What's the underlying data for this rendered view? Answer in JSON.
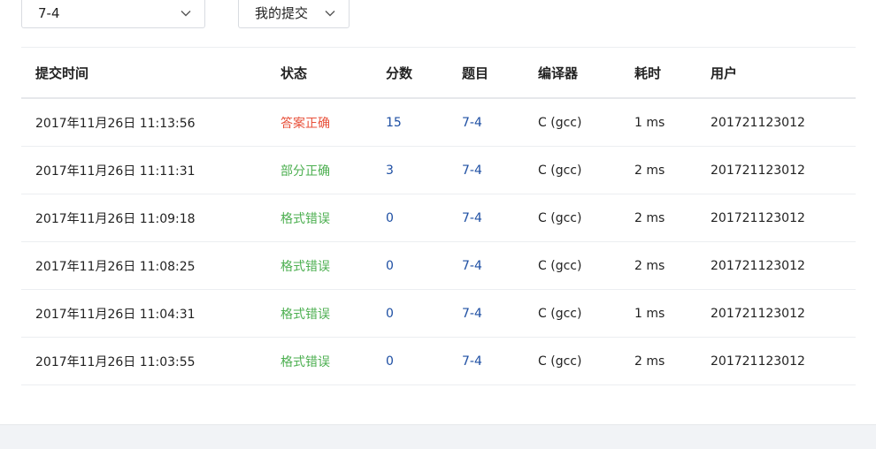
{
  "filters": {
    "problem_value": "7-4",
    "scope_value": "我的提交"
  },
  "table": {
    "headers": {
      "time": "提交时间",
      "status": "状态",
      "score": "分数",
      "problem": "题目",
      "compiler": "编译器",
      "duration": "耗时",
      "user": "用户"
    },
    "rows": [
      {
        "time": "2017年11月26日 11:13:56",
        "status": "答案正确",
        "status_type": "correct",
        "score": "15",
        "problem": "7-4",
        "compiler": "C (gcc)",
        "duration": "1 ms",
        "user": "201721123012"
      },
      {
        "time": "2017年11月26日 11:11:31",
        "status": "部分正确",
        "status_type": "partial",
        "score": "3",
        "problem": "7-4",
        "compiler": "C (gcc)",
        "duration": "2 ms",
        "user": "201721123012"
      },
      {
        "time": "2017年11月26日 11:09:18",
        "status": "格式错误",
        "status_type": "format",
        "score": "0",
        "problem": "7-4",
        "compiler": "C (gcc)",
        "duration": "2 ms",
        "user": "201721123012"
      },
      {
        "time": "2017年11月26日 11:08:25",
        "status": "格式错误",
        "status_type": "format",
        "score": "0",
        "problem": "7-4",
        "compiler": "C (gcc)",
        "duration": "2 ms",
        "user": "201721123012"
      },
      {
        "time": "2017年11月26日 11:04:31",
        "status": "格式错误",
        "status_type": "format",
        "score": "0",
        "problem": "7-4",
        "compiler": "C (gcc)",
        "duration": "1 ms",
        "user": "201721123012"
      },
      {
        "time": "2017年11月26日 11:03:55",
        "status": "格式错误",
        "status_type": "format",
        "score": "0",
        "problem": "7-4",
        "compiler": "C (gcc)",
        "duration": "2 ms",
        "user": "201721123012"
      }
    ]
  },
  "colors": {
    "status_correct": "#e8503a",
    "status_partial": "#4caf50",
    "status_format": "#4caf50",
    "link": "#1e4fa3"
  },
  "icons": {
    "dropdown": "chevron-down-icon"
  }
}
